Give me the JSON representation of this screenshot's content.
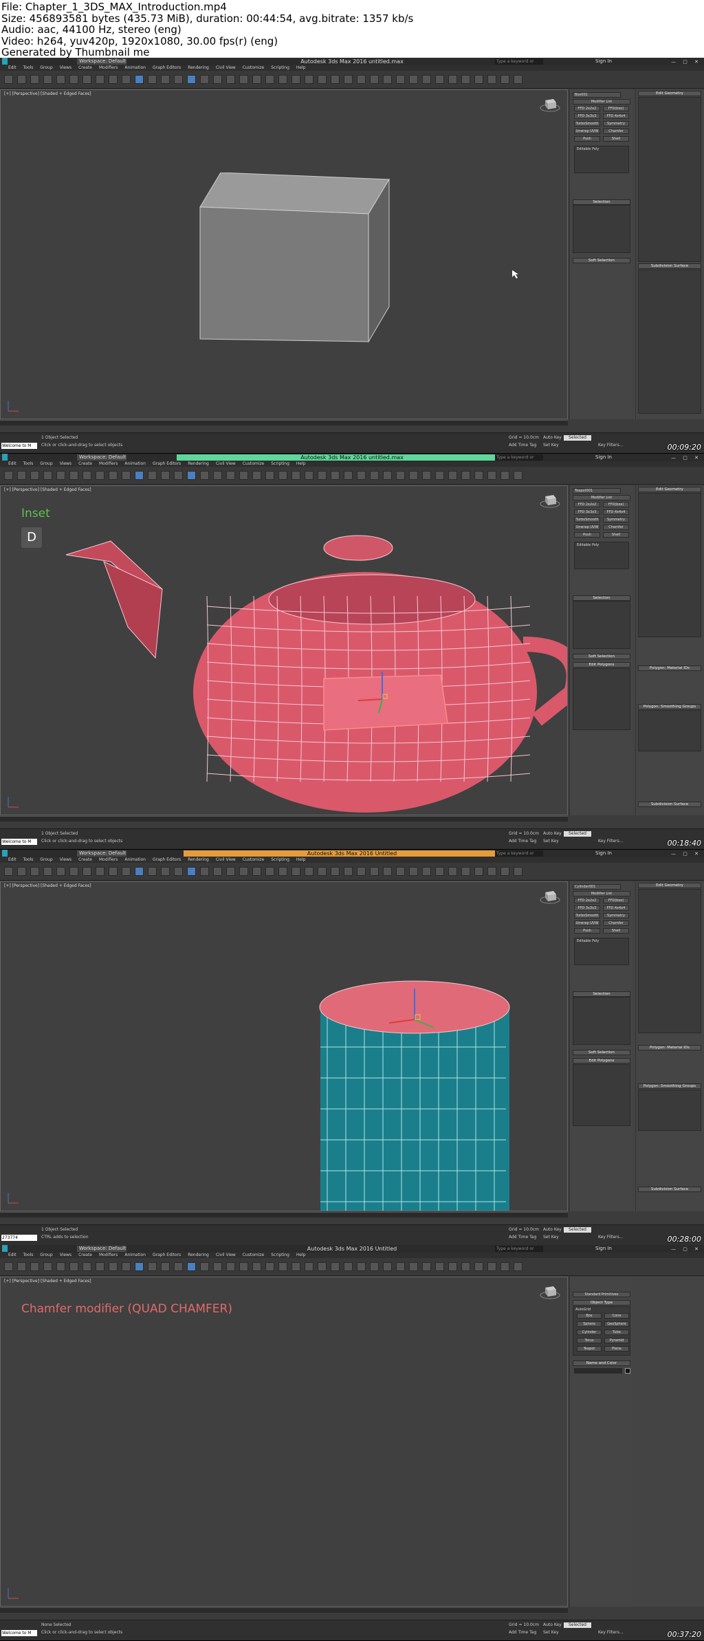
{
  "header": {
    "line1": "File: Chapter_1_3DS_MAX_Introduction.mp4",
    "line2": "Size: 456893581 bytes (435.73 MiB), duration: 00:44:54, avg.bitrate: 1357 kb/s",
    "line3": "Audio: aac, 44100 Hz, stereo (eng)",
    "line4": "Video: h264, yuv420p, 1920x1080, 30.00 fps(r) (eng)",
    "line5": "Generated by Thumbnail me"
  },
  "app": {
    "workspace": "Workspace: Default",
    "search_placeholder": "Type a keyword or phrase",
    "sign_in": "Sign In",
    "menu": [
      "Edit",
      "Tools",
      "Group",
      "Views",
      "Create",
      "Modifiers",
      "Animation",
      "Graph Editors",
      "Rendering",
      "Civil View",
      "Customize",
      "Scripting",
      "Help"
    ],
    "viewport_label": "[+] [Perspective] [Shaded + Edged Faces]",
    "add_time_tag": "Add Time Tag",
    "auto_key": "Auto Key",
    "set_key": "Set Key",
    "key_filters": "Key Filters...",
    "selected": "Selected",
    "grid": "Grid = 10.0cm"
  },
  "frames": [
    {
      "title": "Autodesk 3ds Max 2016     untitled.max",
      "title_highlight": "none",
      "object_name": "Box001",
      "modifier_stack_item": "Editable Poly",
      "selection_status": "1 Object Selected",
      "hint": "Click or click-and-drag to select objects",
      "welcome": "Welcome to M",
      "timestamp": "00:09:20",
      "overlay_title": "",
      "overlay_key": ""
    },
    {
      "title": "Autodesk 3ds Max 2016     untitled.max",
      "title_highlight": "green",
      "object_name": "Teapot001",
      "modifier_stack_item": "Editable Poly",
      "selection_status": "1 Object Selected",
      "hint": "Click or click-and-drag to select objects",
      "welcome": "Welcome to M",
      "timestamp": "00:18:40",
      "overlay_title": "Inset",
      "overlay_key": "D"
    },
    {
      "title": "Autodesk 3ds Max 2016     Untitled",
      "title_highlight": "orange",
      "object_name": "Cylinder001",
      "modifier_stack_item": "Editable Poly",
      "selection_status": "1 Object Selected",
      "hint": "CTRL adds to selection",
      "welcome": "273774",
      "timestamp": "00:28:00",
      "overlay_title": "",
      "overlay_key": ""
    },
    {
      "title": "Autodesk 3ds Max 2016     Untitled",
      "title_highlight": "none",
      "object_name": "",
      "modifier_stack_item": "",
      "selection_status": "None Selected",
      "hint": "Click or click-and-drag to select objects",
      "welcome": "Welcome to M",
      "timestamp": "00:37:20",
      "overlay_title": "Chamfer modifier (QUAD CHAMFER)",
      "overlay_key": ""
    }
  ],
  "panel": {
    "modifier_list": "Modifier List",
    "mod_buttons": [
      "FFD 2x2x2",
      "FFD(box)",
      "FFD 3x3x3",
      "FFD 4x4x4",
      "TurboSmooth",
      "Symmetry",
      "Unwrap UVW",
      "Chamfer",
      "Push",
      "Shell"
    ],
    "edit_geometry": "Edit Geometry",
    "selection": "Selection",
    "soft_selection": "Soft Selection",
    "edit_polygons": "Edit Polygons",
    "subdivision_surface": "Subdivision Surface",
    "polygon_material_ids": "Polygon: Material IDs",
    "smoothing_groups": "Polygon: Smoothing Groups",
    "object_type": "Object Type",
    "standard_primitives": "Standard Primitives",
    "autogrid": "AutoGrid",
    "primitives": [
      "Box",
      "Cone",
      "Sphere",
      "GeoSphere",
      "Cylinder",
      "Tube",
      "Torus",
      "Pyramid",
      "Teapot",
      "Plane"
    ],
    "name_and_color": "Name and Color"
  },
  "colors": {
    "teapot": "#d9596b",
    "cylinder_body": "#1a7f8a",
    "cylinder_cap": "#e06a78",
    "inset_label": "#5ec24f",
    "chamfer_label": "#e46a6a"
  }
}
